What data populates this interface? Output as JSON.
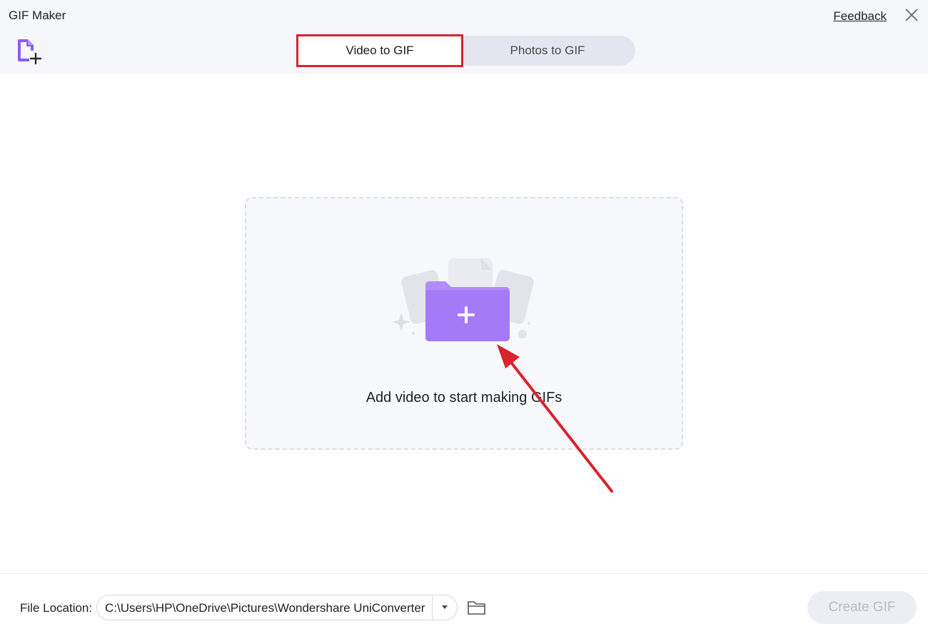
{
  "window": {
    "title": "GIF Maker",
    "feedback_link": "Feedback"
  },
  "toolbar": {
    "add_file_icon": "add-file-icon",
    "close_icon": "close-icon"
  },
  "tabs": [
    {
      "label": "Video to GIF",
      "active": true
    },
    {
      "label": "Photos to GIF",
      "active": false
    }
  ],
  "dropzone": {
    "text": "Add video to start making GIFs",
    "icon": "add-folder-icon"
  },
  "footer": {
    "location_label": "File Location:",
    "location_value": "C:\\Users\\HP\\OneDrive\\Pictures\\Wondershare UniConverter",
    "create_button": "Create GIF",
    "create_enabled": false
  },
  "colors": {
    "accent_purple": "#9d6cf5",
    "highlight_red": "#d9232d",
    "header_bg": "#f6f7fa",
    "disabled_btn_bg": "#eceef4"
  }
}
